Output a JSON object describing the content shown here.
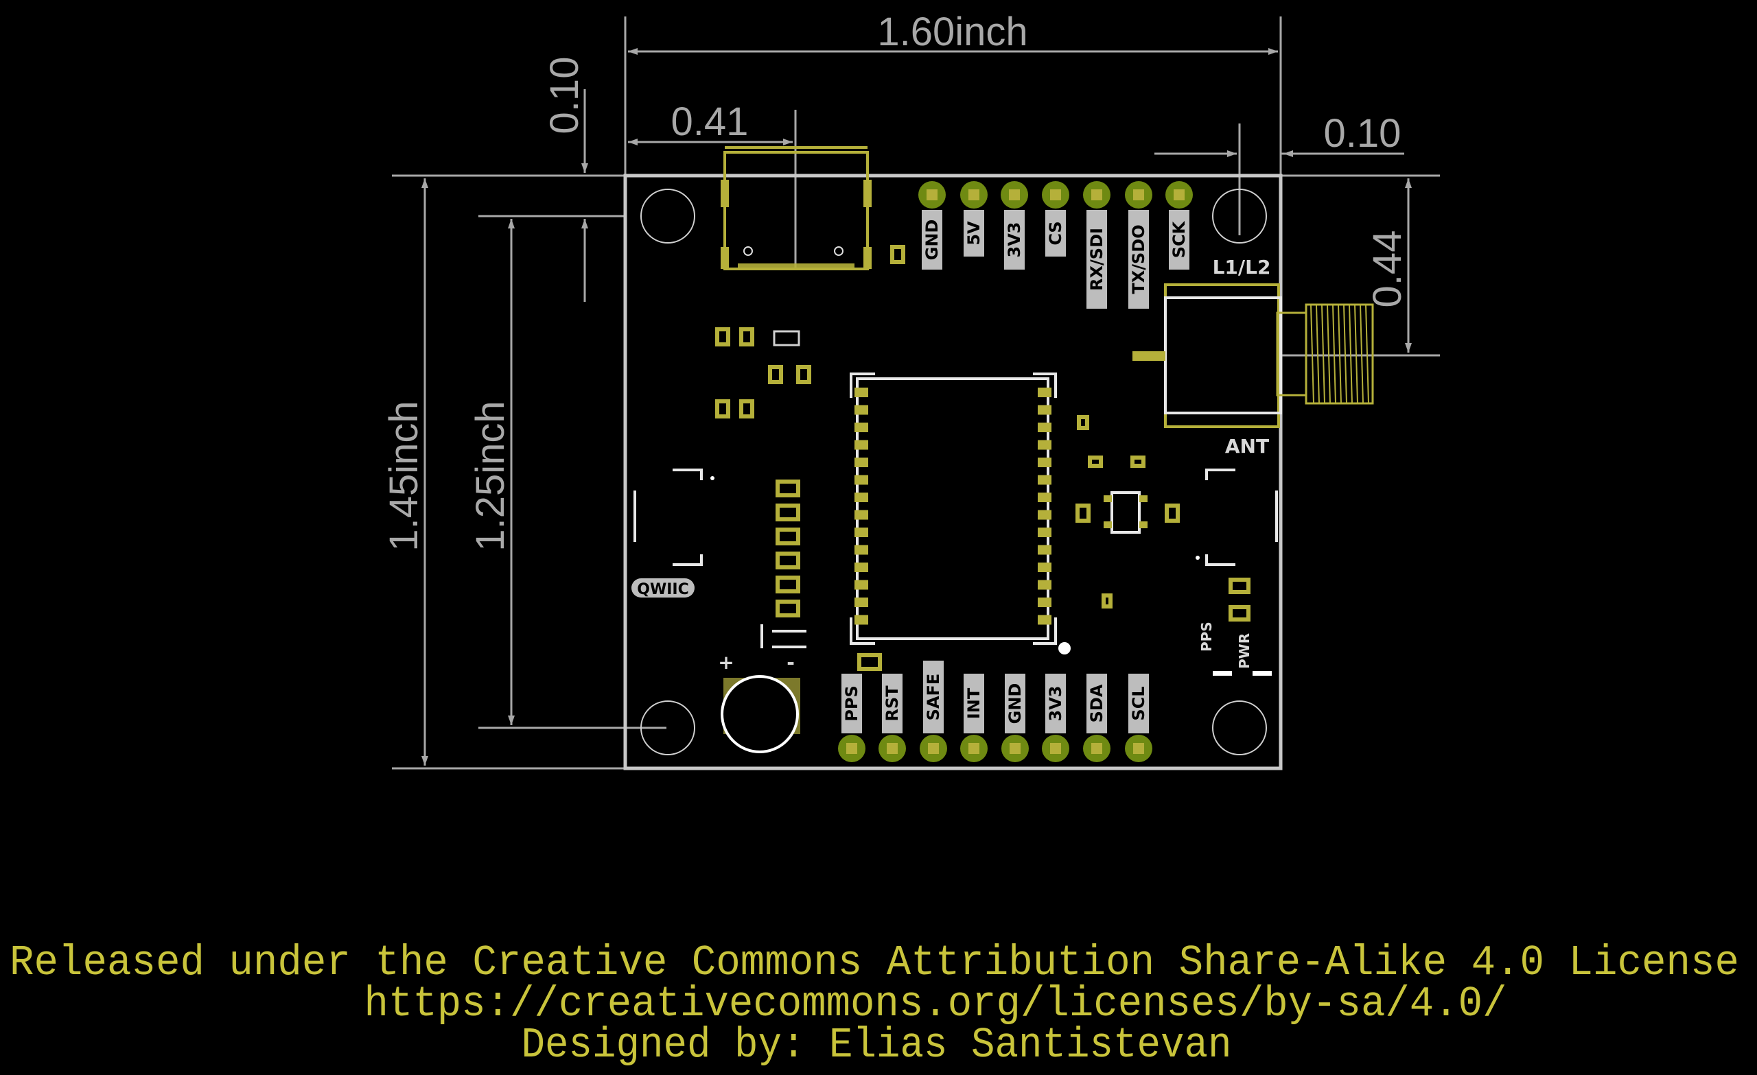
{
  "dimensions": {
    "board_width": "1.60inch",
    "board_height": "1.45inch",
    "hole_spacing_vertical": "1.25inch",
    "usb_offset": "0.41",
    "hole_offset_top": "0.10",
    "hole_offset_right": "0.10",
    "antenna_offset": "0.44"
  },
  "top_header": [
    "GND",
    "5V",
    "3V3",
    "CS",
    "RX/SDI",
    "TX/SDO",
    "SCK"
  ],
  "bottom_header": [
    "PPS",
    "RST",
    "SAFE",
    "INT",
    "GND",
    "3V3",
    "SDA",
    "SCL"
  ],
  "silkscreen": {
    "l1l2": "L1/L2",
    "ant": "ANT",
    "qwiic": "QWIIC",
    "pps_led": "PPS",
    "pwr_led": "PWR",
    "plus": "+",
    "minus": "-"
  },
  "footer": {
    "license": "Released under the Creative Commons Attribution Share-Alike 4.0 License",
    "url": "https://creativecommons.org/licenses/by-sa/4.0/",
    "designer": "Designed by: Elias Santistevan"
  },
  "colors": {
    "background": "#000000",
    "dimension": "#a8a8a8",
    "pad": "#b5b03a",
    "ring": "#6f8a12",
    "silkscreen": "#e8e8e8",
    "footer_text": "#c9c43b"
  }
}
